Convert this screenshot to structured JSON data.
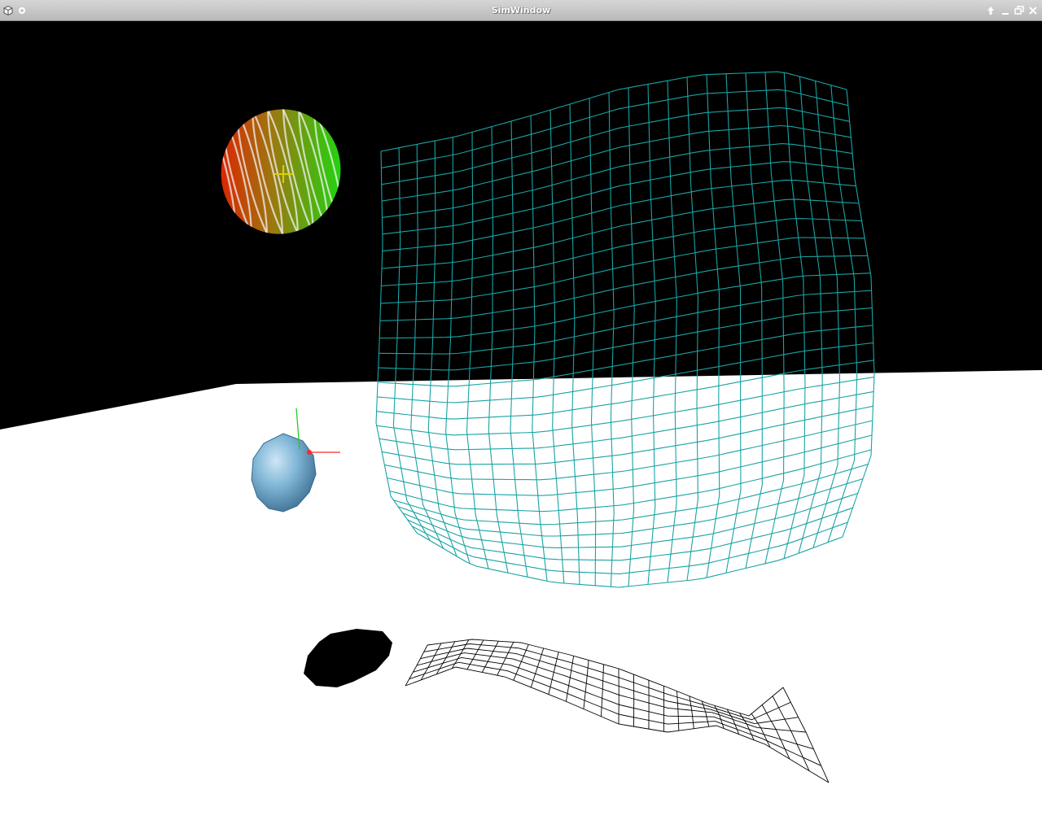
{
  "window": {
    "title": "SimWindow",
    "icons": {
      "app": "cube-icon",
      "menu": "circle-menu-icon",
      "shade": "arrow-up-icon",
      "minimize": "minimize-icon",
      "maximize": "maximize-icon",
      "close": "close-icon"
    }
  },
  "scene": {
    "colors": {
      "sky": "#000000",
      "ground": "#ffffff",
      "cloth_mesh": "#1aa3a3",
      "ribbon_mesh": "#000000",
      "blue_sphere": "#7fb6d8",
      "axis_x": "#ff2a2a",
      "axis_y": "#22cc22"
    }
  }
}
